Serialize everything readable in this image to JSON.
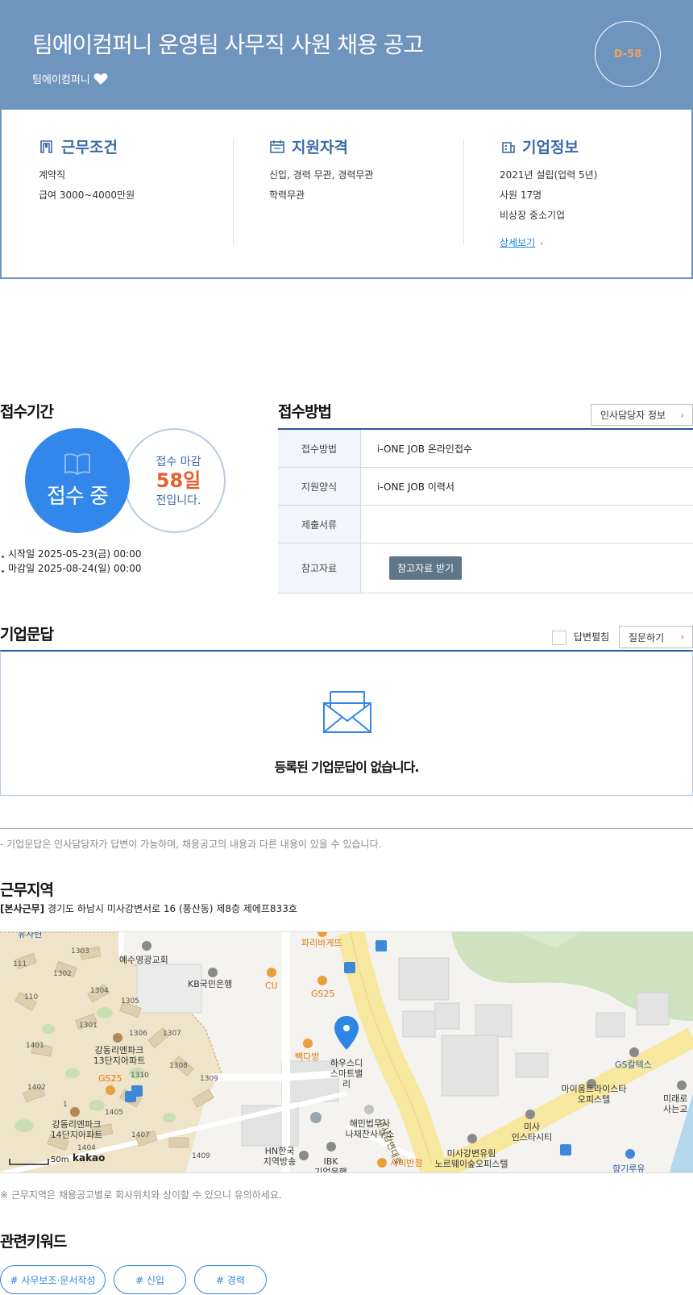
{
  "header": {
    "title": "팀에이컴퍼니 운영팀 사무직 사원 채용 공고",
    "company": "팀에이컴퍼니",
    "dday": "D-58",
    "bg_color": "#6f94be"
  },
  "info": {
    "work": {
      "title": "근무조건",
      "lines": [
        "계약직",
        "급여 3000~4000만원"
      ]
    },
    "qual": {
      "title": "지원자격",
      "lines": [
        "신입, 경력 무관, 경력무관",
        "학력무관"
      ]
    },
    "company": {
      "title": "기업정보",
      "lines": [
        "2021년 설립(업력 5년)",
        "사원 17명",
        "비상장 중소기업"
      ],
      "more": "상세보기"
    }
  },
  "period": {
    "title": "접수기간",
    "status": "접수 중",
    "deadline_top": "접수 마감",
    "days_left": "58일",
    "deadline_bottom": "전입니다.",
    "start": "시작일 2025-05-23(금) 00:00",
    "end": "마감일 2025-08-24(일) 00:00"
  },
  "method": {
    "title": "접수방법",
    "hr_button": "인사담당자 정보",
    "rows": [
      {
        "label": "접수방법",
        "value": "i-ONE JOB 온라인접수"
      },
      {
        "label": "지원양식",
        "value": "i-ONE JOB 이력서"
      },
      {
        "label": "제출서류",
        "value": ""
      },
      {
        "label": "참고자료",
        "value": ""
      }
    ],
    "ref_button": "참고자료 받기"
  },
  "qa": {
    "title": "기업문답",
    "fold_label": "답변펼침",
    "fold_checked": false,
    "ask_button": "질문하기",
    "empty": "등록된 기업문답이 없습니다.",
    "note": "- 기업문답은 인사담당자가 답변이 가능하며, 채용공고의 내용과 다른 내용이 있을 수 있습니다."
  },
  "location": {
    "title": "근무지역",
    "tag": "[본사근무]",
    "address": "경기도 하남시 미사강변서로 16 (풍산동) 제8층 제에프833호",
    "note": "※ 근무지역은 채용공고별로 회사위치와 상이할 수 있으니 유의하세요.",
    "map": {
      "labels": {
        "church": "예수영광교회",
        "kb": "KB국민은행",
        "cu": "CU",
        "gs25a": "GS25",
        "paris": "파리바게뜨",
        "paik": "빽다방",
        "housedi": "하우스디\n스마트밸리",
        "apt13": "강동리엔파크\n13단지아파트",
        "apt14": "강동리엔파크\n14단지아파트",
        "gs25b": "GS25",
        "haemin": "해민법무사\n나채찬사무소",
        "hn": "HN한국\n지역방송",
        "ibk": "IBK\n기업은행",
        "samibanjeom": "사미반점",
        "road": "미사강변대로",
        "gscaltex": "GS칼텍스",
        "maium": "마이움트라이스타\n오피스텔",
        "misa_insta": "미사\n인스타시티",
        "misa_yurim": "미사강변유림\n노르웨이숲오피스텔",
        "mirae": "미래로\n사는교",
        "hyanggi": "향기루유",
        "yusaran": "유사련",
        "scale": "50m",
        "kakao": "kakao",
        "bldg": [
          "1303",
          "111",
          "1302",
          "110",
          "1304",
          "1305",
          "1301",
          "1306",
          "1307",
          "1401",
          "1308",
          "1310",
          "1309",
          "1402",
          "1405",
          "1407",
          "1404",
          "1409",
          "1"
        ]
      }
    }
  },
  "keywords": {
    "title": "관련키워드",
    "items": [
      "# 사무보조·문서작성",
      "# 신입",
      "# 경력"
    ]
  }
}
